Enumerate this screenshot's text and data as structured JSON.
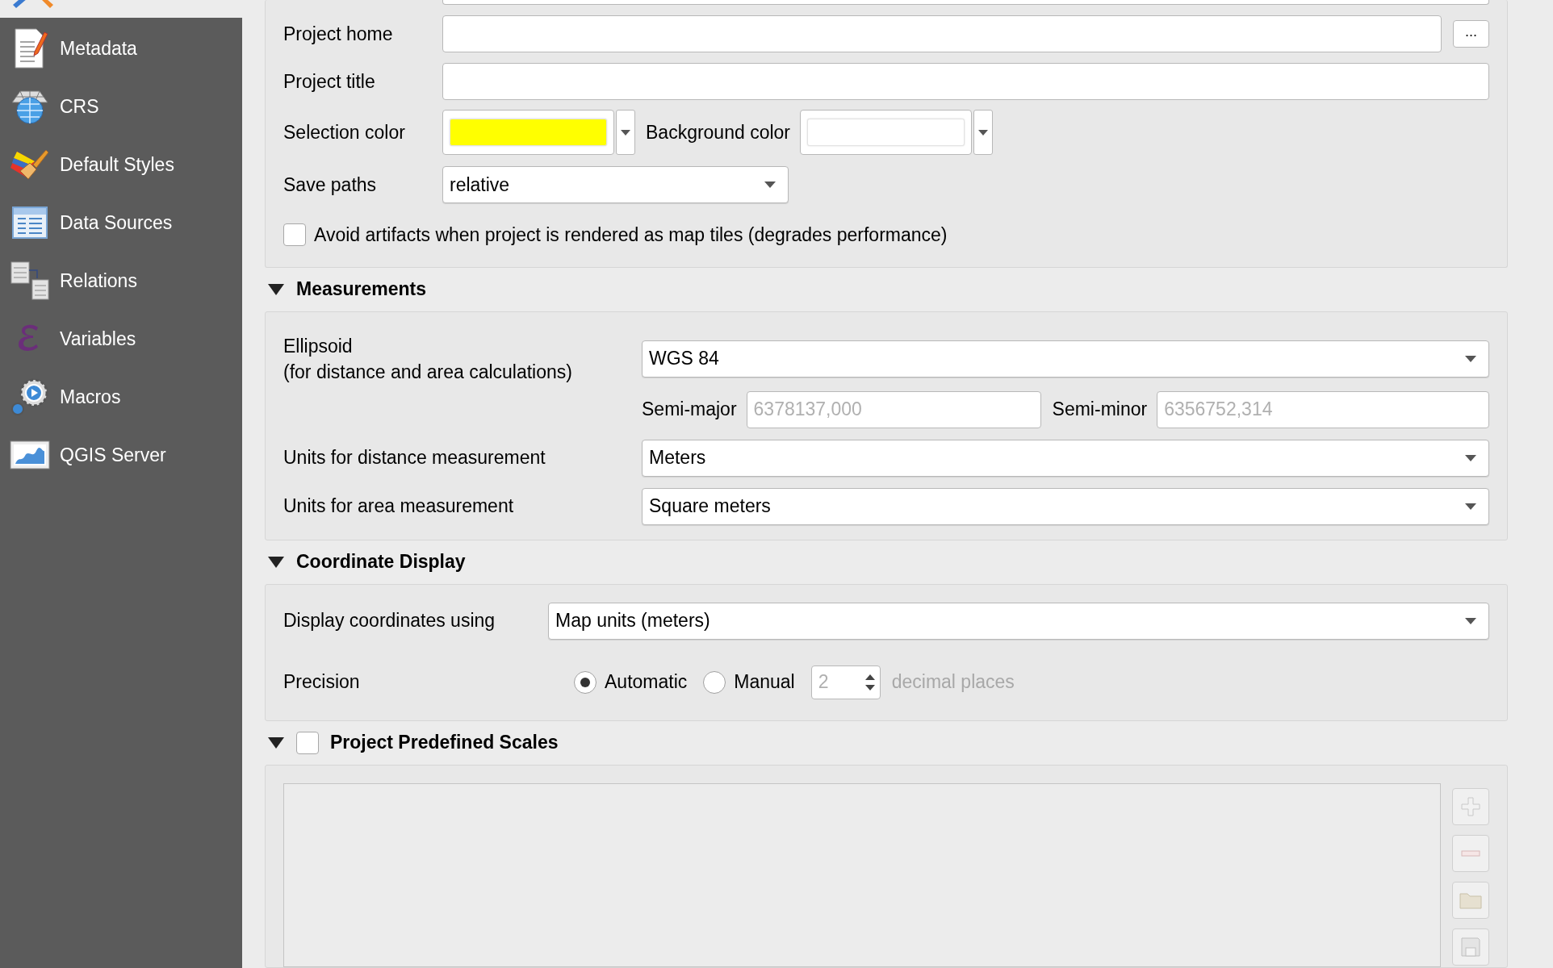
{
  "sidebar": {
    "items": [
      {
        "label": "Metadata"
      },
      {
        "label": "CRS"
      },
      {
        "label": "Default Styles"
      },
      {
        "label": "Data Sources"
      },
      {
        "label": "Relations"
      },
      {
        "label": "Variables"
      },
      {
        "label": "Macros"
      },
      {
        "label": "QGIS Server"
      }
    ]
  },
  "general": {
    "project_home": {
      "label": "Project home",
      "browse_button": "..."
    },
    "project_title": {
      "label": "Project title"
    },
    "selection_color": {
      "label": "Selection color",
      "color": "#ffff00"
    },
    "background_color": {
      "label": "Background color",
      "color": "#ffffff"
    },
    "save_paths": {
      "label": "Save paths",
      "value": "relative"
    },
    "avoid_artifacts": {
      "label": "Avoid artifacts when project is rendered as map tiles (degrades performance)",
      "checked": false
    }
  },
  "measurements": {
    "title": "Measurements",
    "expanded": true,
    "ellipsoid": {
      "label": "Ellipsoid\n(for distance and area calculations)",
      "value": "WGS 84"
    },
    "semi_major": {
      "label": "Semi-major",
      "value": "6378137,000",
      "disabled": true
    },
    "semi_minor": {
      "label": "Semi-minor",
      "value": "6356752,314",
      "disabled": true
    },
    "distance_units": {
      "label": "Units for distance measurement",
      "value": "Meters"
    },
    "area_units": {
      "label": "Units for area measurement",
      "value": "Square meters"
    }
  },
  "coordinate_display": {
    "title": "Coordinate Display",
    "expanded": true,
    "display": {
      "label": "Display coordinates using",
      "value": "Map units (meters)"
    },
    "precision": {
      "label": "Precision",
      "options": [
        {
          "label": "Automatic",
          "selected": true
        },
        {
          "label": "Manual",
          "selected": false
        }
      ],
      "places": {
        "value": "2",
        "disabled": true
      },
      "suffix": "decimal places",
      "suffix_disabled": true
    }
  },
  "predefined_scales": {
    "title": "Project Predefined Scales",
    "expanded": true,
    "checked": false
  }
}
